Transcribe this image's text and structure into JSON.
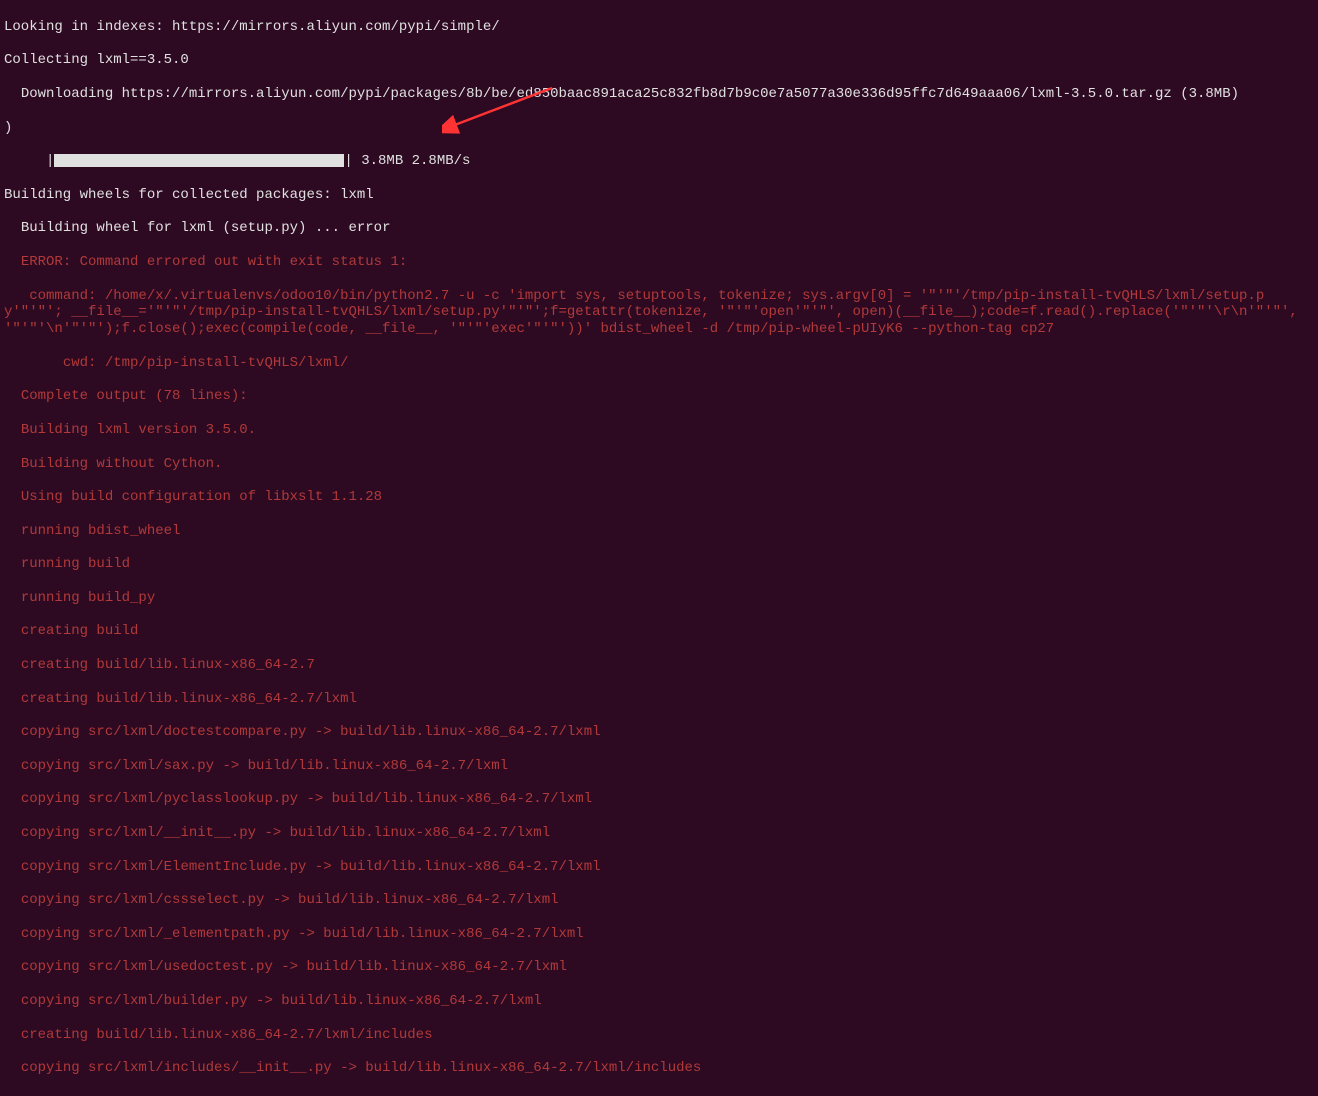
{
  "lines": {
    "l1": "Looking in indexes: https://mirrors.aliyun.com/pypi/simple/",
    "l2": "Collecting lxml==3.5.0",
    "l3": "  Downloading https://mirrors.aliyun.com/pypi/packages/8b/be/ed850baac891aca25c832fb8d7b9c0e7a5077a30e336d95ffc7d649aaa06/lxml-3.5.0.tar.gz (3.8MB)",
    "l4_close": ")",
    "progress_prefix": "     |",
    "progress_suffix": "| 3.8MB 2.8MB/s",
    "l5": "Building wheels for collected packages: lxml",
    "l6": "  Building wheel for lxml (setup.py) ... error",
    "e1": "  ERROR: Command errored out with exit status 1:",
    "e2": "   command: /home/x/.virtualenvs/odoo10/bin/python2.7 -u -c 'import sys, setuptools, tokenize; sys.argv[0] = '\"'\"'/tmp/pip-install-tvQHLS/lxml/setup.py'\"'\"'; __file__='\"'\"'/tmp/pip-install-tvQHLS/lxml/setup.py'\"'\"';f=getattr(tokenize, '\"'\"'open'\"'\"', open)(__file__);code=f.read().replace('\"'\"'\\r\\n'\"'\"', '\"'\"'\\n'\"'\"');f.close();exec(compile(code, __file__, '\"'\"'exec'\"'\"'))' bdist_wheel -d /tmp/pip-wheel-pUIyK6 --python-tag cp27",
    "e3": "       cwd: /tmp/pip-install-tvQHLS/lxml/",
    "e4": "  Complete output (78 lines):",
    "e5": "  Building lxml version 3.5.0.",
    "e6": "  Building without Cython.",
    "e7": "  Using build configuration of libxslt 1.1.28",
    "e8": "  running bdist_wheel",
    "e9": "  running build",
    "e10": "  running build_py",
    "e11": "  creating build",
    "e12": "  creating build/lib.linux-x86_64-2.7",
    "e13": "  creating build/lib.linux-x86_64-2.7/lxml",
    "e14": "  copying src/lxml/doctestcompare.py -> build/lib.linux-x86_64-2.7/lxml",
    "e15": "  copying src/lxml/sax.py -> build/lib.linux-x86_64-2.7/lxml",
    "e16": "  copying src/lxml/pyclasslookup.py -> build/lib.linux-x86_64-2.7/lxml",
    "e17": "  copying src/lxml/__init__.py -> build/lib.linux-x86_64-2.7/lxml",
    "e18": "  copying src/lxml/ElementInclude.py -> build/lib.linux-x86_64-2.7/lxml",
    "e19": "  copying src/lxml/cssselect.py -> build/lib.linux-x86_64-2.7/lxml",
    "e20": "  copying src/lxml/_elementpath.py -> build/lib.linux-x86_64-2.7/lxml",
    "e21": "  copying src/lxml/usedoctest.py -> build/lib.linux-x86_64-2.7/lxml",
    "e22": "  copying src/lxml/builder.py -> build/lib.linux-x86_64-2.7/lxml",
    "e23": "  creating build/lib.linux-x86_64-2.7/lxml/includes",
    "e24": "  copying src/lxml/includes/__init__.py -> build/lib.linux-x86_64-2.7/lxml/includes"
  }
}
